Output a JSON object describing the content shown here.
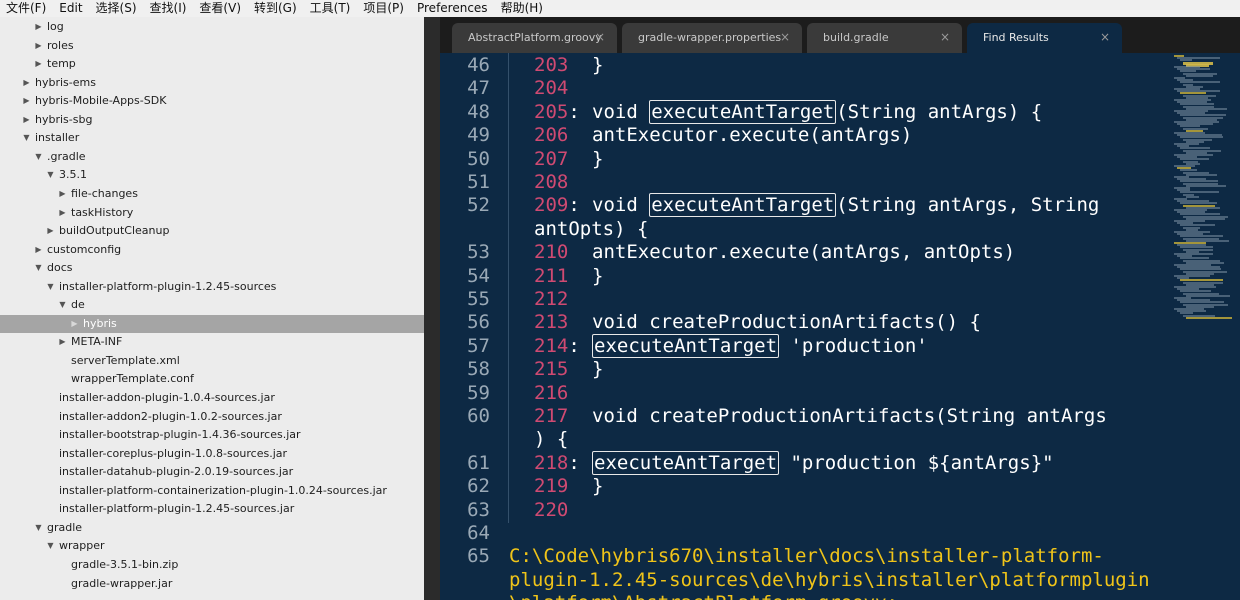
{
  "menubar": [
    "文件(F)",
    "Edit",
    "选择(S)",
    "查找(I)",
    "查看(V)",
    "转到(G)",
    "工具(T)",
    "项目(P)",
    "Preferences",
    "帮助(H)"
  ],
  "sidebar": {
    "selected_index": 16,
    "items": [
      {
        "label": "log",
        "depth": 2,
        "arrow": "closed"
      },
      {
        "label": "roles",
        "depth": 2,
        "arrow": "closed"
      },
      {
        "label": "temp",
        "depth": 2,
        "arrow": "closed"
      },
      {
        "label": "hybris-ems",
        "depth": 1,
        "arrow": "closed"
      },
      {
        "label": "hybris-Mobile-Apps-SDK",
        "depth": 1,
        "arrow": "closed"
      },
      {
        "label": "hybris-sbg",
        "depth": 1,
        "arrow": "closed"
      },
      {
        "label": "installer",
        "depth": 1,
        "arrow": "open"
      },
      {
        "label": ".gradle",
        "depth": 2,
        "arrow": "open"
      },
      {
        "label": "3.5.1",
        "depth": 3,
        "arrow": "open"
      },
      {
        "label": "file-changes",
        "depth": 4,
        "arrow": "closed"
      },
      {
        "label": "taskHistory",
        "depth": 4,
        "arrow": "closed"
      },
      {
        "label": "buildOutputCleanup",
        "depth": 3,
        "arrow": "closed"
      },
      {
        "label": "customconfig",
        "depth": 2,
        "arrow": "closed"
      },
      {
        "label": "docs",
        "depth": 2,
        "arrow": "open"
      },
      {
        "label": "installer-platform-plugin-1.2.45-sources",
        "depth": 3,
        "arrow": "open"
      },
      {
        "label": "de",
        "depth": 4,
        "arrow": "open"
      },
      {
        "label": "hybris",
        "depth": 5,
        "arrow": "closed"
      },
      {
        "label": "META-INF",
        "depth": 4,
        "arrow": "closed"
      },
      {
        "label": "serverTemplate.xml",
        "depth": 4,
        "arrow": "none"
      },
      {
        "label": "wrapperTemplate.conf",
        "depth": 4,
        "arrow": "none"
      },
      {
        "label": "installer-addon-plugin-1.0.4-sources.jar",
        "depth": 3,
        "arrow": "none"
      },
      {
        "label": "installer-addon2-plugin-1.0.2-sources.jar",
        "depth": 3,
        "arrow": "none"
      },
      {
        "label": "installer-bootstrap-plugin-1.4.36-sources.jar",
        "depth": 3,
        "arrow": "none"
      },
      {
        "label": "installer-coreplus-plugin-1.0.8-sources.jar",
        "depth": 3,
        "arrow": "none"
      },
      {
        "label": "installer-datahub-plugin-2.0.19-sources.jar",
        "depth": 3,
        "arrow": "none"
      },
      {
        "label": "installer-platform-containerization-plugin-1.0.24-sources.jar",
        "depth": 3,
        "arrow": "none"
      },
      {
        "label": "installer-platform-plugin-1.2.45-sources.jar",
        "depth": 3,
        "arrow": "none"
      },
      {
        "label": "gradle",
        "depth": 2,
        "arrow": "open"
      },
      {
        "label": "wrapper",
        "depth": 3,
        "arrow": "open"
      },
      {
        "label": "gradle-3.5.1-bin.zip",
        "depth": 4,
        "arrow": "none"
      },
      {
        "label": "gradle-wrapper.jar",
        "depth": 4,
        "arrow": "none"
      }
    ]
  },
  "tabs": [
    {
      "label": "AbstractPlatform.groovy",
      "active": false
    },
    {
      "label": "gradle-wrapper.properties",
      "active": false
    },
    {
      "label": "build.gradle",
      "active": false
    },
    {
      "label": "Find Results",
      "active": true
    }
  ],
  "tab_close_glyph": "×",
  "highlight_term": "executeAntTarget",
  "code_lines": [
    {
      "gutter": "46",
      "ref": "203",
      "colon": false,
      "text": "    }"
    },
    {
      "gutter": "47",
      "ref": "204",
      "colon": false,
      "text": ""
    },
    {
      "gutter": "48",
      "ref": "205",
      "colon": true,
      "text": "    void executeAntTarget(String antArgs) {"
    },
    {
      "gutter": "49",
      "ref": "206",
      "colon": false,
      "text": "        antExecutor.execute(antArgs)"
    },
    {
      "gutter": "50",
      "ref": "207",
      "colon": false,
      "text": "    }"
    },
    {
      "gutter": "51",
      "ref": "208",
      "colon": false,
      "text": ""
    },
    {
      "gutter": "52",
      "ref": "209",
      "colon": true,
      "text": "    void executeAntTarget(String antArgs, String",
      "wrap": "antOpts) {"
    },
    {
      "gutter": "53",
      "ref": "210",
      "colon": false,
      "text": "        antExecutor.execute(antArgs, antOpts)"
    },
    {
      "gutter": "54",
      "ref": "211",
      "colon": false,
      "text": "    }"
    },
    {
      "gutter": "55",
      "ref": "212",
      "colon": false,
      "text": ""
    },
    {
      "gutter": "56",
      "ref": "213",
      "colon": false,
      "text": "    void createProductionArtifacts() {"
    },
    {
      "gutter": "57",
      "ref": "214",
      "colon": true,
      "text": "        executeAntTarget 'production'"
    },
    {
      "gutter": "58",
      "ref": "215",
      "colon": false,
      "text": "    }"
    },
    {
      "gutter": "59",
      "ref": "216",
      "colon": false,
      "text": ""
    },
    {
      "gutter": "60",
      "ref": "217",
      "colon": false,
      "text": "    void createProductionArtifacts(String antArgs",
      "wrap_ref": ") {"
    },
    {
      "gutter": "61",
      "ref": "218",
      "colon": true,
      "text": "        executeAntTarget \"production ${antArgs}\""
    },
    {
      "gutter": "62",
      "ref": "219",
      "colon": false,
      "text": "    }"
    },
    {
      "gutter": "63",
      "ref": "220",
      "colon": false,
      "text": ""
    },
    {
      "gutter": "64",
      "ref": "",
      "colon": false,
      "text": ""
    },
    {
      "gutter": "65",
      "ref": "",
      "colon": false,
      "path": "C:\\Code\\hybris670\\installer\\docs\\installer-platform-",
      "path_wrap": [
        "plugin-1.2.45-sources\\de\\hybris\\installer\\platformplugin",
        "\\platform\\AbstractPlatform.groovy:"
      ]
    }
  ],
  "colors": {
    "editor_bg": "#0d2944",
    "line_ref": "#d04a72",
    "path": "#f0c419",
    "gutter": "#9aa9b6"
  }
}
